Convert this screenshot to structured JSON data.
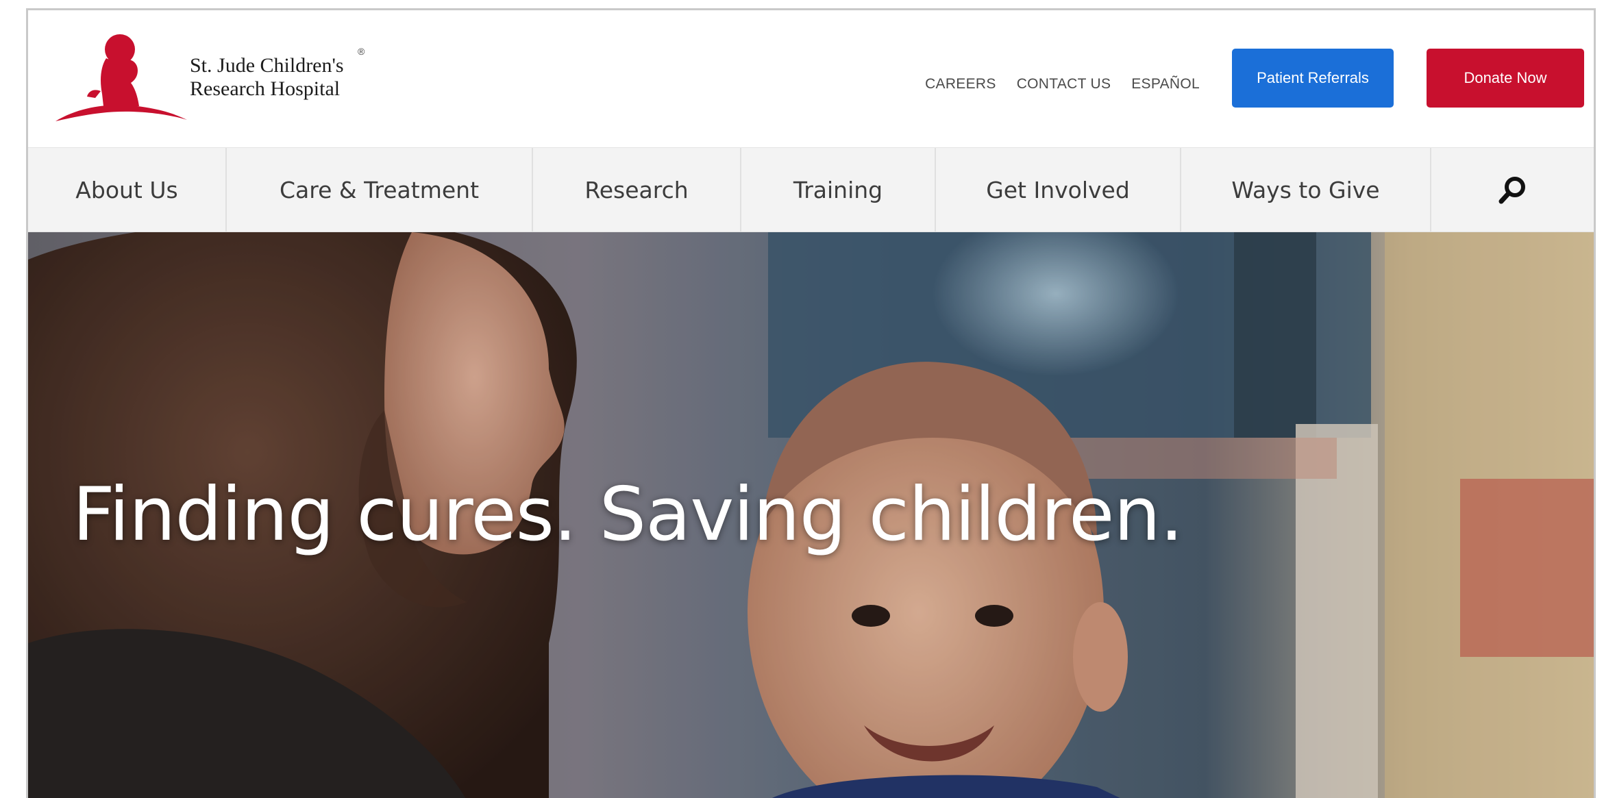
{
  "brand": {
    "name_line1": "St. Jude Children's",
    "name_line2": "Research Hospital",
    "registered": "®",
    "color": "#c8102e"
  },
  "utility_nav": {
    "careers": "CAREERS",
    "contact": "CONTACT US",
    "espanol": "ESPAÑOL"
  },
  "buttons": {
    "referrals": "Patient Referrals",
    "referrals_color": "#1b6fd8",
    "donate": "Donate Now",
    "donate_color": "#c8102e"
  },
  "main_nav": {
    "items": [
      {
        "label": "About Us"
      },
      {
        "label": "Care & Treatment"
      },
      {
        "label": "Research"
      },
      {
        "label": "Training"
      },
      {
        "label": "Get Involved"
      },
      {
        "label": "Ways to Give"
      }
    ],
    "search_icon": "search-icon"
  },
  "hero": {
    "headline": "Finding cures. Saving children."
  }
}
